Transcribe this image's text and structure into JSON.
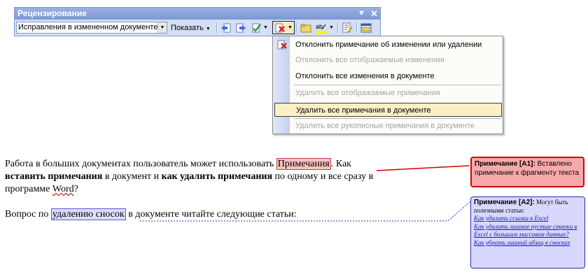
{
  "toolbar": {
    "title": "Рецензирование",
    "combo_value": "Исправления в измененном документе",
    "show_button": "Показать"
  },
  "menu": {
    "items": [
      {
        "label": "Отклонить примечание об изменении или удалении",
        "disabled": false
      },
      {
        "label": "Отклонить все отображаемые изменения",
        "disabled": true
      },
      {
        "label": "Отклонить все изменения в документе",
        "disabled": false
      },
      {
        "label": "Удалить все отображаемые примечания",
        "disabled": true
      },
      {
        "label": "Удалить все примечания в документе",
        "disabled": false,
        "highlighted": true
      },
      {
        "label": "Удалить все рукописные примечания в документе",
        "disabled": true
      }
    ]
  },
  "document": {
    "p1_l1_a": "Работа в больших документах пользователь может использовать ",
    "p1_l1_mark": "Примечания",
    "p1_l1_b": ". Как",
    "p1_l2_bold1": "вставить примечания",
    "p1_l2_mid": " в документ и ",
    "p1_l2_bold2": "как удалить примечания",
    "p1_l2_end": " по одному и все сразу в",
    "p1_l3_a": "программе ",
    "p1_l3_word": "Word",
    "p1_l3_b": "?",
    "p2_a": "Вопрос по ",
    "p2_mark": "удалению сносок",
    "p2_b": " в документе читайте следующие статьи:"
  },
  "comments": {
    "c1_head": "Примечание [A1]:",
    "c1_text": " Вставлено примечание к фрагменту текста",
    "c2_head": "Примечание [A2]:",
    "c2_text": " Могут быть полезными статьи:",
    "c2_links": [
      "Как удалить ссылки в Excel",
      "Как удалить лишние пустые строки в Excel с большим массивом данных?",
      "Как убрать лишний абзац в сносках"
    ]
  },
  "colors": {
    "toolbar_bg": "#d4dff5",
    "title_bar": "#7d97d4",
    "menu_highlight": "#fbefc5",
    "comment1_bg": "#f7a9a9",
    "comment1_border": "#d40000",
    "comment2_bg": "#d8d8ff",
    "comment2_border": "#2b2bb5"
  }
}
